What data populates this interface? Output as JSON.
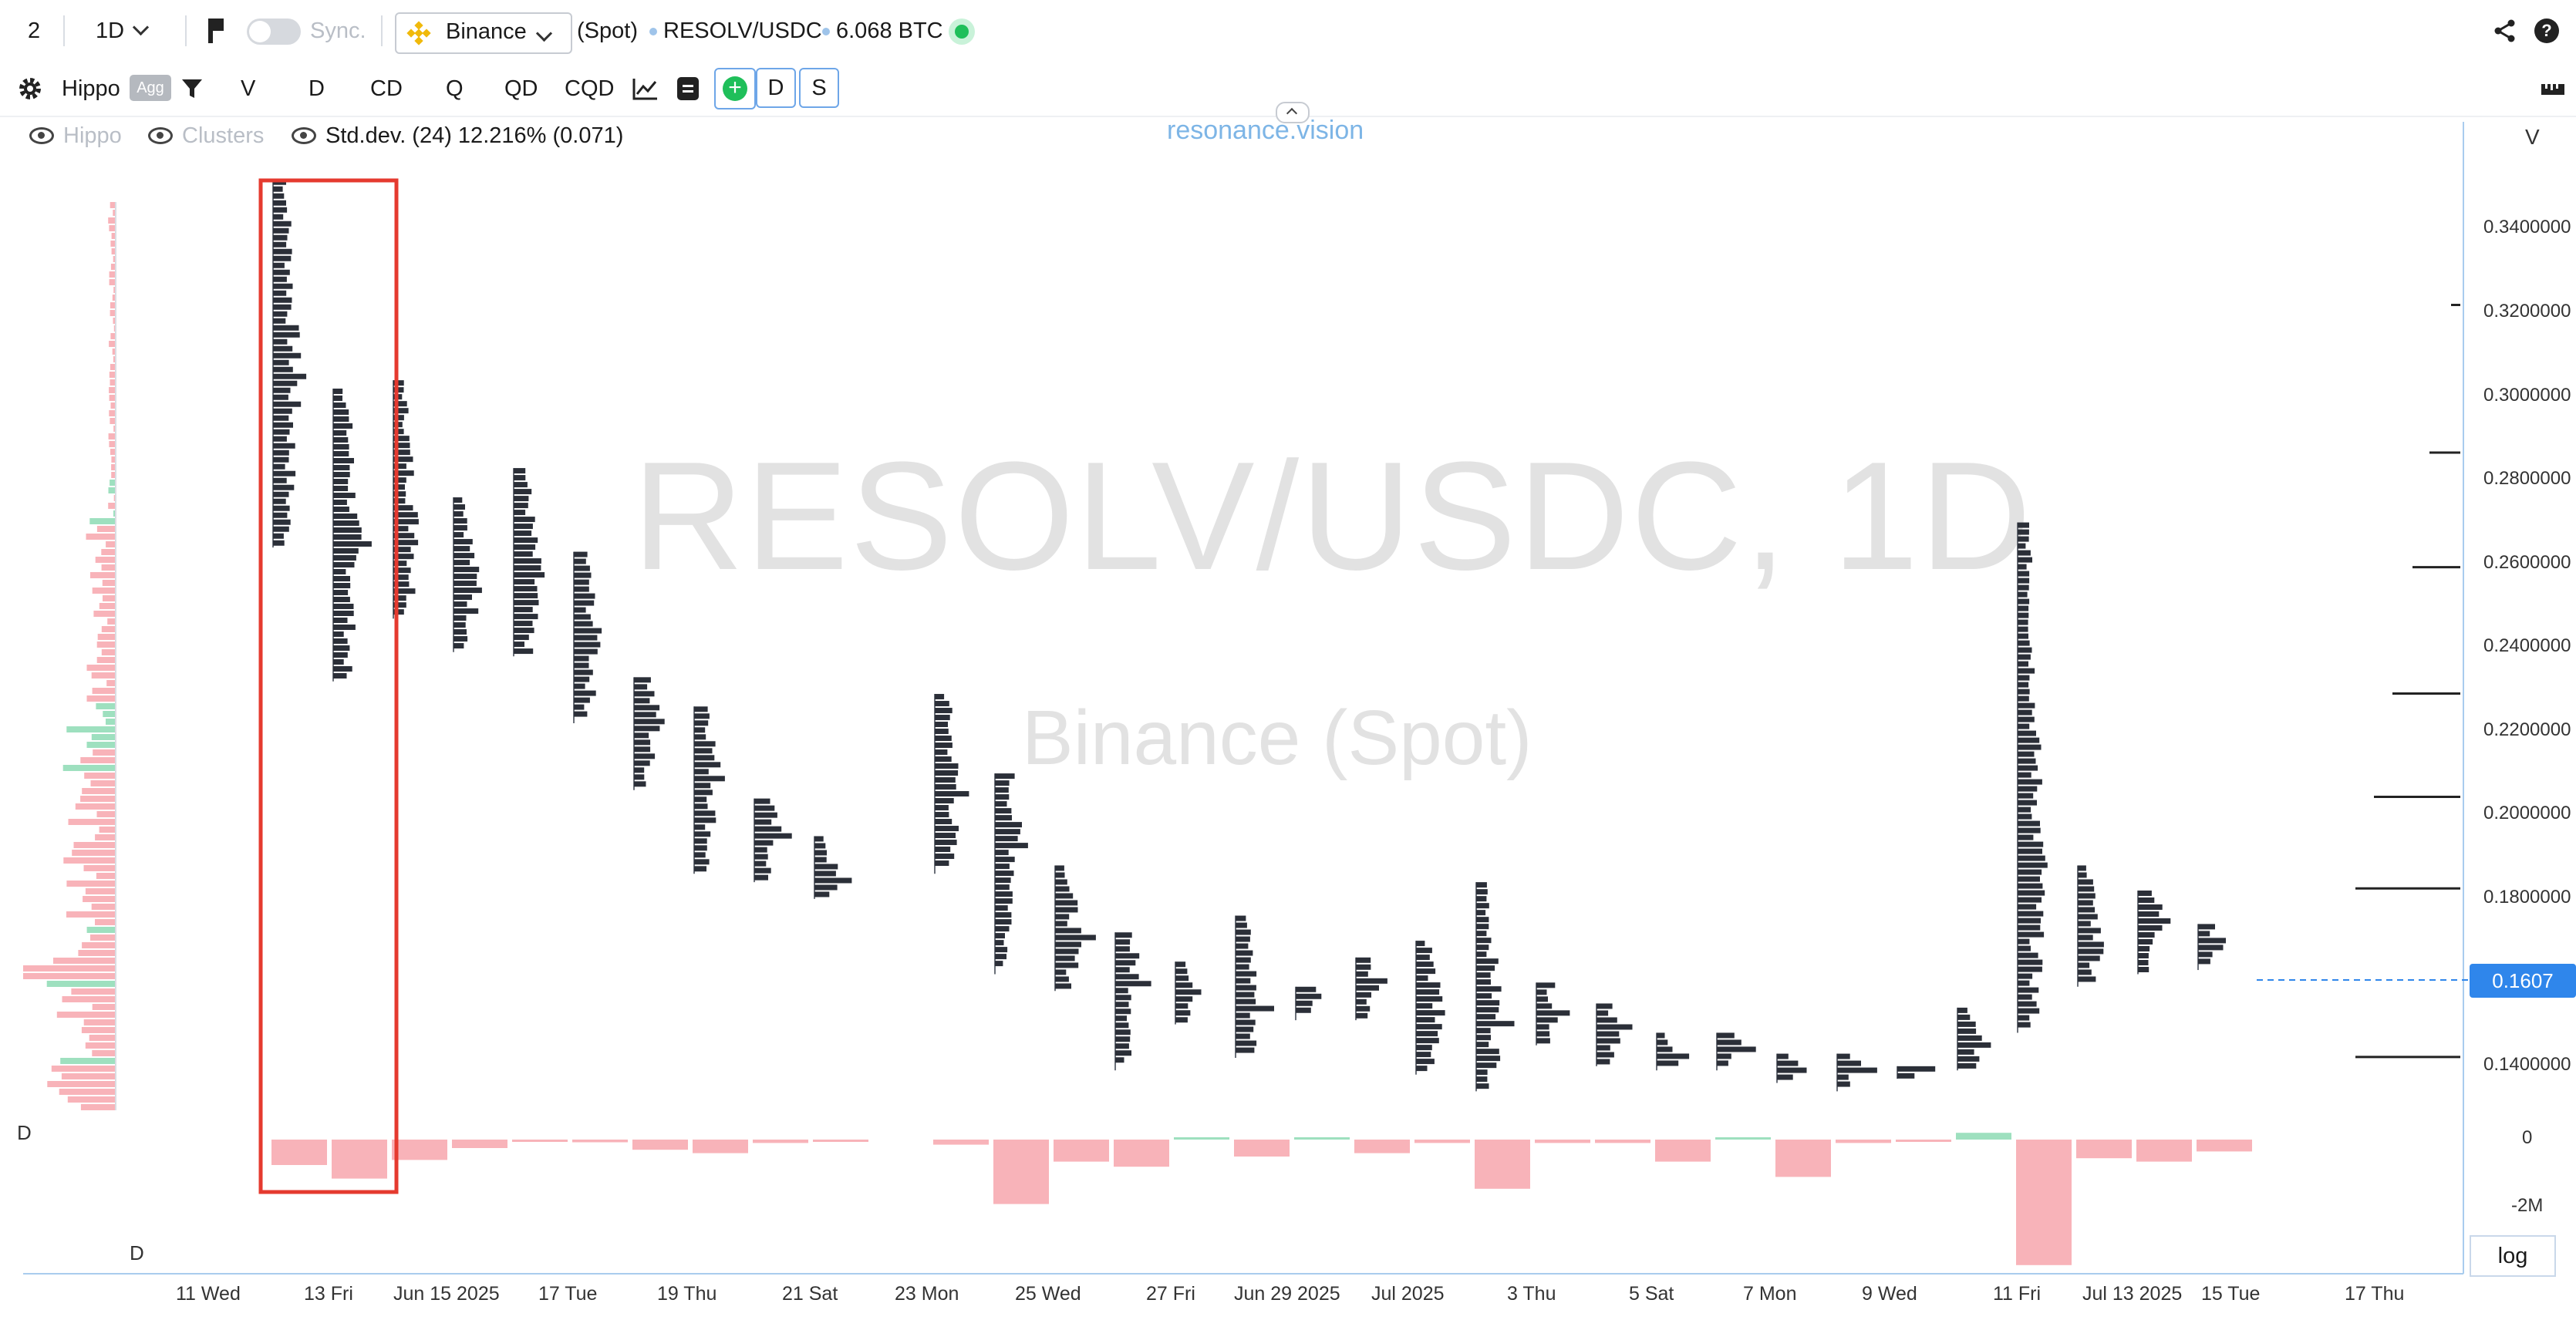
{
  "top": {
    "layout_number": "2",
    "interval": "1D",
    "sync_label": "Sync.",
    "exchange": "Binance",
    "market": "(Spot)",
    "pair": "RESOLV/USDC",
    "volume": "6.068 BTC"
  },
  "toolbar": {
    "profile": "Hippo",
    "agg_badge": "Agg",
    "modes": [
      "V",
      "D",
      "CD",
      "Q",
      "QD",
      "CQD"
    ],
    "d_button": "D",
    "s_button": "S"
  },
  "legend": {
    "hippo": "Hippo",
    "clusters": "Clusters",
    "stddev": "Std.dev. (24) 12.216% (0.071)"
  },
  "brand": "resonance.vision",
  "watermark": {
    "line1": "RESOLV/USDC, 1D",
    "line2": "Binance (Spot)"
  },
  "right_axis": {
    "header": "V",
    "price_ticks": [
      "0.3400000",
      "0.3200000",
      "0.3000000",
      "0.2800000",
      "0.2600000",
      "0.2400000",
      "0.2200000",
      "0.2000000",
      "0.1800000",
      "0.1400000"
    ],
    "delta_ticks": [
      "0",
      "-2M"
    ],
    "current_price": "0.1607",
    "log_button": "log"
  },
  "left_labels": {
    "delta_label": "D",
    "bottom_label": "D"
  },
  "x_axis": [
    "11 Wed",
    "13 Fri",
    "Jun 15 2025",
    "17 Tue",
    "19 Thu",
    "21 Sat",
    "23 Mon",
    "25 Wed",
    "27 Fri",
    "Jun 29 2025",
    "Jul 2025",
    "3 Thu",
    "5 Sat",
    "7 Mon",
    "9 Wed",
    "11 Fri",
    "Jul 13 2025",
    "15 Tue",
    "17 Thu"
  ],
  "chart_data": {
    "type": "volume-profile-candles",
    "price_range": [
      0.13,
      0.355
    ],
    "current_price": 0.1607,
    "highlight": "red rectangle around Jun 12–13 sessions",
    "colors": {
      "profile": "#2b2f38",
      "sell": "#f8b3b9",
      "buy": "#9ee0bf",
      "highlight": "#e53a2f",
      "price_line": "#2f86eb"
    },
    "days": [
      {
        "label": "Jun 12",
        "high": 0.35,
        "low": 0.262,
        "delta": -0.75
      },
      {
        "label": "Jun 13",
        "high": 0.3,
        "low": 0.23,
        "delta": -1.15
      },
      {
        "label": "Jun 14",
        "high": 0.302,
        "low": 0.245,
        "delta": -0.6
      },
      {
        "label": "Jun 15",
        "high": 0.274,
        "low": 0.237,
        "delta": -0.25
      },
      {
        "label": "Jun 16",
        "high": 0.281,
        "low": 0.236,
        "delta": -0.05
      },
      {
        "label": "Jun 17",
        "high": 0.261,
        "low": 0.22,
        "delta": -0.08
      },
      {
        "label": "Jun 18",
        "high": 0.231,
        "low": 0.204,
        "delta": -0.3
      },
      {
        "label": "Jun 19",
        "high": 0.224,
        "low": 0.184,
        "delta": -0.4
      },
      {
        "label": "Jun 20",
        "high": 0.202,
        "low": 0.182,
        "delta": -0.1
      },
      {
        "label": "Jun 21",
        "high": 0.193,
        "low": 0.178,
        "delta": -0.05
      },
      {
        "label": "Jun 23",
        "high": 0.227,
        "low": 0.184,
        "delta": -0.15
      },
      {
        "label": "Jun 24",
        "high": 0.208,
        "low": 0.16,
        "delta": -1.9
      },
      {
        "label": "Jun 25",
        "high": 0.186,
        "low": 0.156,
        "delta": -0.65
      },
      {
        "label": "Jun 26",
        "high": 0.17,
        "low": 0.137,
        "delta": -0.8
      },
      {
        "label": "Jun 27",
        "high": 0.163,
        "low": 0.148,
        "delta": 0.05
      },
      {
        "label": "Jun 28",
        "high": 0.174,
        "low": 0.14,
        "delta": -0.5
      },
      {
        "label": "Jun 29",
        "high": 0.157,
        "low": 0.149,
        "delta": 0.05
      },
      {
        "label": "Jun 30",
        "high": 0.164,
        "low": 0.149,
        "delta": -0.4
      },
      {
        "label": "Jul 01",
        "high": 0.168,
        "low": 0.136,
        "delta": -0.1
      },
      {
        "label": "Jul 02",
        "high": 0.182,
        "low": 0.132,
        "delta": -1.45
      },
      {
        "label": "Jul 03",
        "high": 0.158,
        "low": 0.143,
        "delta": -0.1
      },
      {
        "label": "Jul 04",
        "high": 0.153,
        "low": 0.138,
        "delta": -0.1
      },
      {
        "label": "Jul 05",
        "high": 0.146,
        "low": 0.137,
        "delta": -0.65
      },
      {
        "label": "Jul 06",
        "high": 0.146,
        "low": 0.137,
        "delta": 0.05
      },
      {
        "label": "Jul 07",
        "high": 0.141,
        "low": 0.134,
        "delta": -1.1
      },
      {
        "label": "Jul 08",
        "high": 0.141,
        "low": 0.132,
        "delta": -0.1
      },
      {
        "label": "Jul 09",
        "high": 0.138,
        "low": 0.135,
        "delta": -0.05
      },
      {
        "label": "Jul 10",
        "high": 0.152,
        "low": 0.137,
        "delta": 0.2
      },
      {
        "label": "Jul 11",
        "high": 0.268,
        "low": 0.146,
        "delta": -3.7
      },
      {
        "label": "Jul 12",
        "high": 0.186,
        "low": 0.157,
        "delta": -0.55
      },
      {
        "label": "Jul 13",
        "high": 0.18,
        "low": 0.16,
        "delta": -0.65
      },
      {
        "label": "Jul 14",
        "high": 0.172,
        "low": 0.161,
        "delta": -0.35
      }
    ]
  }
}
